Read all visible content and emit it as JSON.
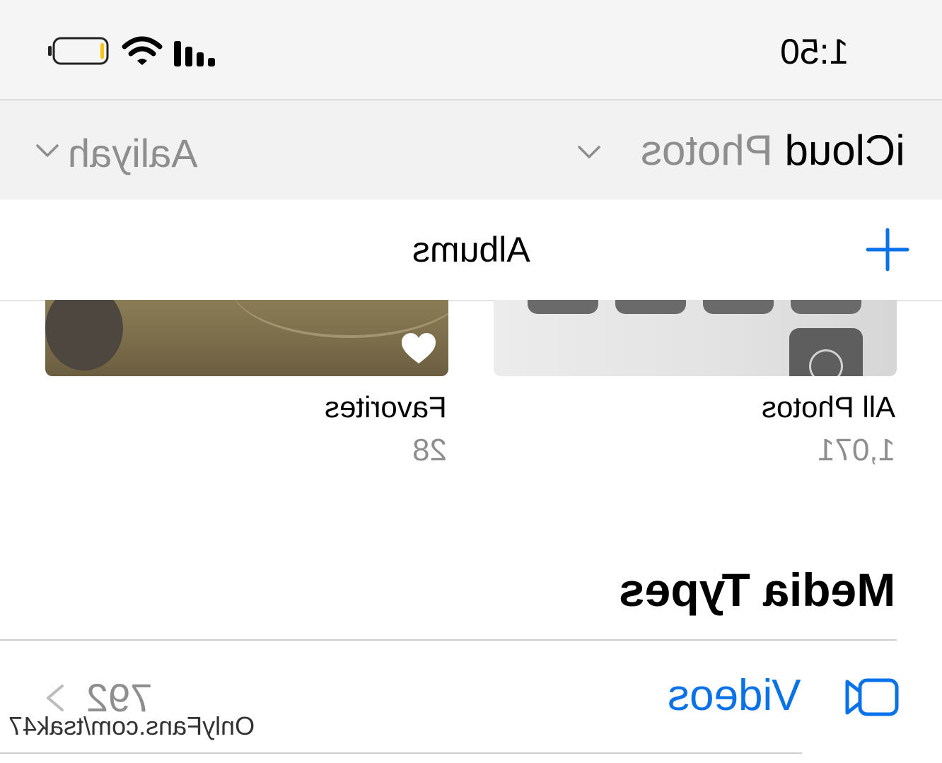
{
  "status_bar": {
    "time": "1:50",
    "battery_icon": "battery-low-icon",
    "wifi_icon": "wifi-icon",
    "signal_icon": "cellular-signal-icon"
  },
  "library_bar": {
    "title_strong": "iCloud",
    "title_muted": "Photos",
    "user_name": "Aaliyah",
    "chevron_icon": "chevron-down-icon"
  },
  "albums_header": {
    "title": "Albums",
    "add_icon": "plus-icon"
  },
  "albums": [
    {
      "name": "All Photos",
      "count": "1,071"
    },
    {
      "name": "Favorites",
      "count": "28",
      "badge_icon": "heart-icon"
    }
  ],
  "media_types": {
    "title": "Media Types",
    "rows": [
      {
        "label": "Videos",
        "count": "792",
        "icon": "video-camera-icon",
        "chevron_icon": "chevron-right-icon"
      }
    ]
  },
  "watermark": "OnlyFans.com/tsak47",
  "colors": {
    "accent": "#0a72e8",
    "muted": "#8e8e8e",
    "battery": "#f5c518"
  }
}
